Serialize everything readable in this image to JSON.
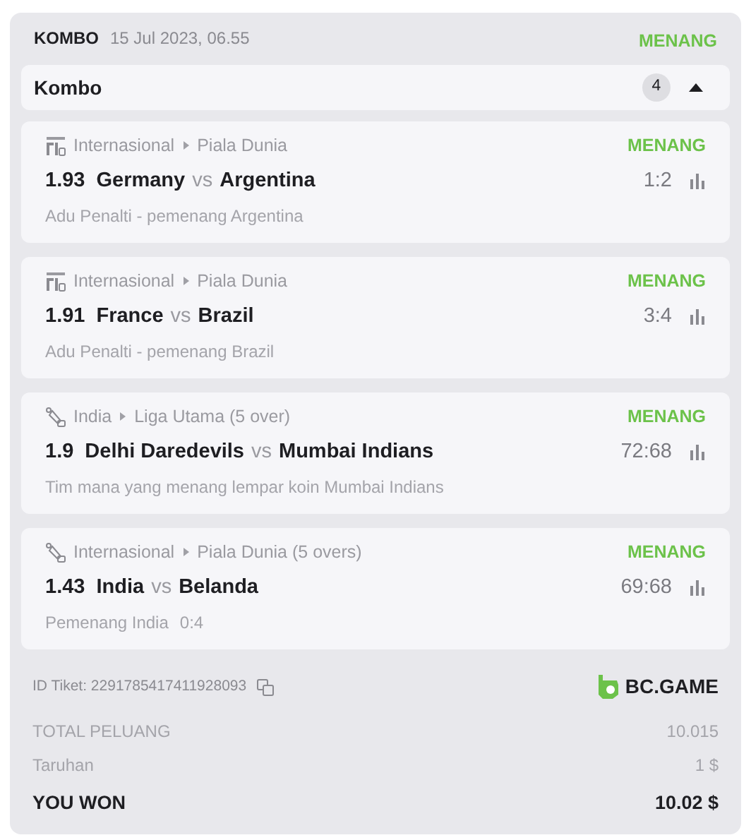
{
  "header": {
    "type": "KOMBO",
    "date": "15 Jul 2023, 06.55",
    "status": "MENANG"
  },
  "kombo": {
    "label": "Kombo",
    "count": "4",
    "expanded": true
  },
  "bets": [
    {
      "kind": "football",
      "region": "Internasional",
      "league": "Piala Dunia",
      "status": "MENANG",
      "odds": "1.93",
      "home": "Germany",
      "vs": "vs",
      "away": "Argentina",
      "score": "1:2",
      "detail": "Adu Penalti - pemenang Argentina"
    },
    {
      "kind": "football",
      "region": "Internasional",
      "league": "Piala Dunia",
      "status": "MENANG",
      "odds": "1.91",
      "home": "France",
      "vs": "vs",
      "away": "Brazil",
      "score": "3:4",
      "detail": "Adu Penalti - pemenang Brazil"
    },
    {
      "kind": "cricket",
      "region": "India",
      "league": "Liga Utama (5 over)",
      "status": "MENANG",
      "odds": "1.9",
      "home": "Delhi Daredevils",
      "vs": "vs",
      "away": "Mumbai Indians",
      "score": "72:68",
      "detail": "Tim mana yang menang lempar koin Mumbai Indians"
    },
    {
      "kind": "cricket",
      "region": "Internasional",
      "league": "Piala Dunia (5 overs)",
      "status": "MENANG",
      "odds": "1.43",
      "home": "India",
      "vs": "vs",
      "away": "Belanda",
      "score": "69:68",
      "detail": "Pemenang India",
      "detail_score": "0:4"
    }
  ],
  "ticket": {
    "label": "ID Tiket: 2291785417411928093",
    "brand": "BC.GAME"
  },
  "summary": [
    {
      "kind": "muted",
      "label": "TOTAL PELUANG",
      "value": "10.015"
    },
    {
      "kind": "muted",
      "label": "Taruhan",
      "value": "1 $"
    },
    {
      "kind": "total",
      "label": "YOU WON",
      "value": "10.02 $"
    }
  ]
}
